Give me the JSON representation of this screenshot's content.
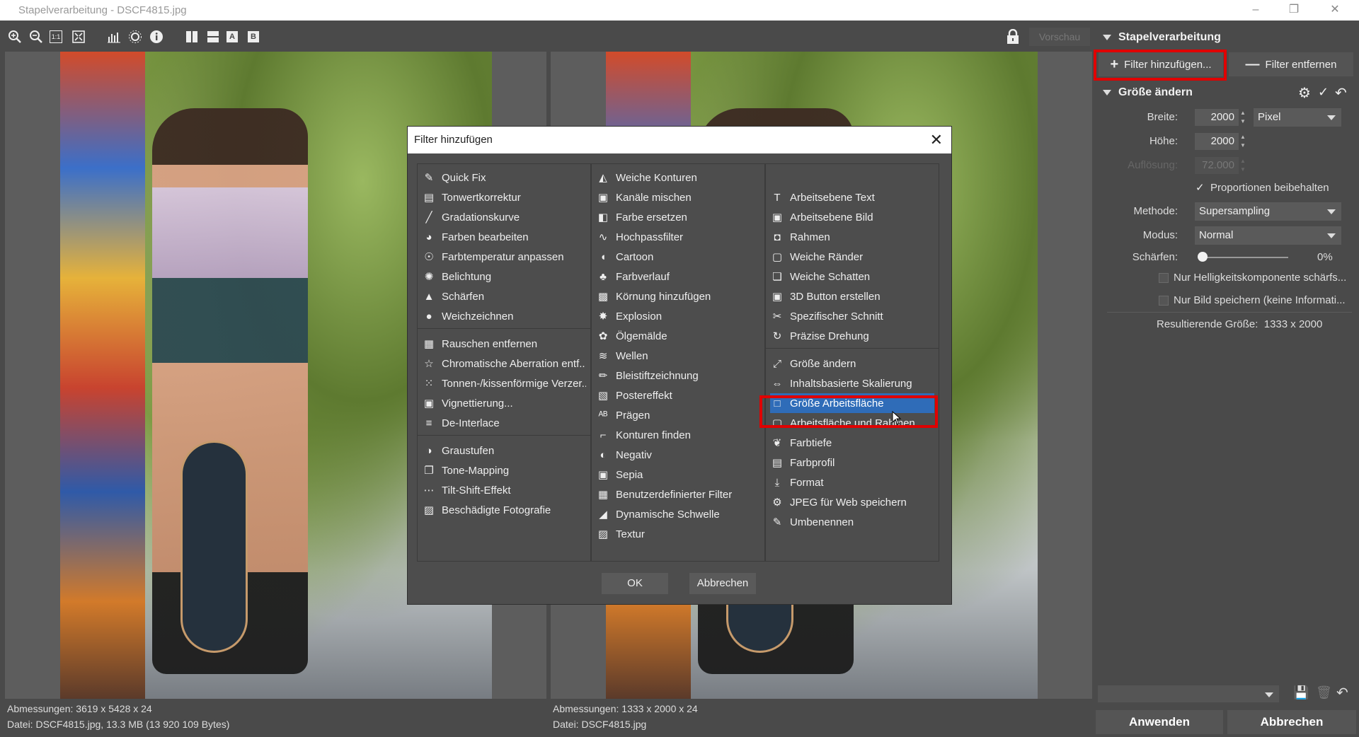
{
  "window": {
    "title": "Stapelverarbeitung - DSCF4815.jpg"
  },
  "toolbar": {
    "icons": [
      "zoom-in-icon",
      "zoom-out-icon",
      "actual-size-icon",
      "fit-icon",
      "histogram-icon",
      "sun-icon",
      "info-icon",
      "split-vertical-icon",
      "split-horizontal-icon",
      "view-a-icon",
      "view-b-icon"
    ],
    "view_a": "A",
    "view_b": "B",
    "zoom_1to1": "1:1",
    "preview_label": "Vorschau"
  },
  "left_pane": {
    "dimensions": "Abmessungen: 3619 x 5428 x 24",
    "file": "Datei: DSCF4815.jpg, 13.3 MB (13 920 109 Bytes)"
  },
  "right_pane": {
    "dimensions": "Abmessungen: 1333 x 2000 x 24",
    "file": "Datei: DSCF4815.jpg"
  },
  "side": {
    "section1": "Stapelverarbeitung",
    "add_filter": "Filter hinzufügen...",
    "remove_filter": "Filter entfernen",
    "section2": "Größe ändern",
    "width_label": "Breite:",
    "width_value": "2000",
    "height_label": "Höhe:",
    "height_value": "2000",
    "resolution_label": "Auflösung:",
    "resolution_value": "72.000",
    "unit": "Pixel",
    "keep_proportions": "Proportionen beibehalten",
    "method_label": "Methode:",
    "method_value": "Supersampling",
    "mode_label": "Modus:",
    "mode_value": "Normal",
    "sharpen_label": "Schärfen:",
    "sharpen_value": "0%",
    "sharpen_level": 0,
    "only_luminance": "Nur Helligkeitskomponente schärfs...",
    "only_image": "Nur Bild speichern (keine Informati...",
    "result_label": "Resultierende Größe:",
    "result_value": "1333 x 2000",
    "apply": "Anwenden",
    "cancel": "Abbrechen"
  },
  "dialog": {
    "title": "Filter hinzufügen",
    "ok": "OK",
    "cancel": "Abbrechen",
    "col1": [
      {
        "label": "Quick Fix",
        "icon": "wand-icon"
      },
      {
        "label": "Tonwertkorrektur",
        "icon": "levels-icon"
      },
      {
        "label": "Gradationskurve",
        "icon": "curve-icon"
      },
      {
        "label": "Farben bearbeiten",
        "icon": "palette-icon"
      },
      {
        "label": "Farbtemperatur anpassen",
        "icon": "bulb-icon"
      },
      {
        "label": "Belichtung",
        "icon": "exposure-icon"
      },
      {
        "label": "Schärfen",
        "icon": "sharpen-icon"
      },
      {
        "label": "Weichzeichnen",
        "icon": "drop-icon"
      },
      {
        "label": "Rauschen entfernen",
        "icon": "noise-icon"
      },
      {
        "label": "Chromatische Aberration entf...",
        "icon": "star-icon"
      },
      {
        "label": "Tonnen-/kissenförmige Verzer...",
        "icon": "grid-dots-icon"
      },
      {
        "label": "Vignettierung...",
        "icon": "vignette-icon"
      },
      {
        "label": "De-Interlace",
        "icon": "interlace-icon"
      },
      {
        "label": "Graustufen",
        "icon": "grayscale-icon"
      },
      {
        "label": "Tone-Mapping",
        "icon": "tone-mapping-icon"
      },
      {
        "label": "Tilt-Shift-Effekt",
        "icon": "tilt-shift-icon"
      },
      {
        "label": "Beschädigte Fotografie",
        "icon": "damaged-photo-icon"
      }
    ],
    "col2": [
      {
        "label": "Weiche Konturen",
        "icon": "soft-contour-icon"
      },
      {
        "label": "Kanäle mischen",
        "icon": "channels-icon"
      },
      {
        "label": "Farbe ersetzen",
        "icon": "replace-color-icon"
      },
      {
        "label": "Hochpassfilter",
        "icon": "highpass-icon"
      },
      {
        "label": "Cartoon",
        "icon": "cartoon-icon"
      },
      {
        "label": "Farbverlauf",
        "icon": "gradient-icon"
      },
      {
        "label": "Körnung hinzufügen",
        "icon": "grain-icon"
      },
      {
        "label": "Explosion",
        "icon": "explosion-icon"
      },
      {
        "label": "Ölgemälde",
        "icon": "oil-paint-icon"
      },
      {
        "label": "Wellen",
        "icon": "waves-icon"
      },
      {
        "label": "Bleistiftzeichnung",
        "icon": "pencil-icon"
      },
      {
        "label": "Postereffekt",
        "icon": "poster-icon"
      },
      {
        "label": "Prägen",
        "icon": "emboss-icon"
      },
      {
        "label": "Konturen finden",
        "icon": "find-edges-icon"
      },
      {
        "label": "Negativ",
        "icon": "negative-icon"
      },
      {
        "label": "Sepia",
        "icon": "sepia-icon"
      },
      {
        "label": "Benutzerdefinierter Filter",
        "icon": "custom-filter-icon"
      },
      {
        "label": "Dynamische Schwelle",
        "icon": "threshold-icon"
      },
      {
        "label": "Textur",
        "icon": "texture-icon"
      }
    ],
    "col3": [
      {
        "label": "Arbeitsebene Text",
        "icon": "text-layer-icon"
      },
      {
        "label": "Arbeitsebene Bild",
        "icon": "image-layer-icon"
      },
      {
        "label": "Rahmen",
        "icon": "frame-icon"
      },
      {
        "label": "Weiche Ränder",
        "icon": "soft-edges-icon"
      },
      {
        "label": "Weiche Schatten",
        "icon": "soft-shadow-icon"
      },
      {
        "label": "3D Button erstellen",
        "icon": "3d-button-icon"
      },
      {
        "label": "Spezifischer Schnitt",
        "icon": "crop-icon"
      },
      {
        "label": "Präzise Drehung",
        "icon": "rotate-icon"
      },
      {
        "label": "Größe ändern",
        "icon": "resize-icon"
      },
      {
        "label": "Inhaltsbasierte Skalierung",
        "icon": "content-scale-icon"
      },
      {
        "label": "Größe Arbeitsfläche",
        "icon": "canvas-size-icon"
      },
      {
        "label": "Arbeitsfläche und Rahmen",
        "icon": "canvas-frame-icon"
      },
      {
        "label": "Farbtiefe",
        "icon": "color-depth-icon"
      },
      {
        "label": "Farbprofil",
        "icon": "color-profile-icon"
      },
      {
        "label": "Format",
        "icon": "format-icon"
      },
      {
        "label": "JPEG für Web speichern",
        "icon": "jpeg-web-icon"
      },
      {
        "label": "Umbenennen",
        "icon": "rename-icon"
      }
    ]
  },
  "colors": {
    "selection": "#2f6cb8",
    "highlight_frame": "#e00000",
    "panel": "#4a4a4a"
  }
}
